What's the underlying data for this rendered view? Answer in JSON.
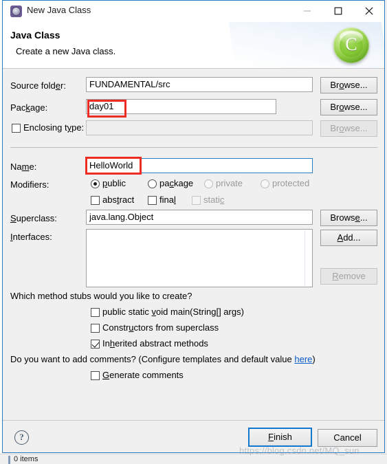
{
  "window": {
    "title": "New Java Class",
    "icon": "eclipse-wizard-icon",
    "controls": {
      "minimize": "—",
      "maximize": "□",
      "close": "✕"
    }
  },
  "banner": {
    "title": "Java Class",
    "subtitle": "Create a new Java class.",
    "logo_letter": "C"
  },
  "form": {
    "source_folder": {
      "label": "Source folder:",
      "value": "FUNDAMENTAL/src",
      "browse_label": "Browse..."
    },
    "package": {
      "label": "Package:",
      "value": "day01",
      "browse_label": "Browse..."
    },
    "enclosing_type": {
      "label": "Enclosing type:",
      "value": "",
      "checked": false,
      "browse_label": "Browse...",
      "disabled": true
    },
    "name": {
      "label": "Name:",
      "value": "HelloWorld"
    },
    "modifiers": {
      "label": "Modifiers:",
      "radios": [
        {
          "label": "public",
          "checked": true,
          "disabled": false
        },
        {
          "label": "package",
          "checked": false,
          "disabled": false
        },
        {
          "label": "private",
          "checked": false,
          "disabled": true
        },
        {
          "label": "protected",
          "checked": false,
          "disabled": true
        }
      ],
      "checkboxes": [
        {
          "label": "abstract",
          "checked": false,
          "disabled": false
        },
        {
          "label": "final",
          "checked": false,
          "disabled": false
        },
        {
          "label": "static",
          "checked": false,
          "disabled": true
        }
      ]
    },
    "superclass": {
      "label": "Superclass:",
      "value": "java.lang.Object",
      "browse_label": "Browse..."
    },
    "interfaces": {
      "label": "Interfaces:",
      "items": [],
      "add_label": "Add...",
      "remove_label": "Remove",
      "remove_disabled": true
    },
    "method_stubs": {
      "question": "Which method stubs would you like to create?",
      "options": [
        {
          "label": "public static void main(String[] args)",
          "checked": false
        },
        {
          "label": "Constructors from superclass",
          "checked": false
        },
        {
          "label": "Inherited abstract methods",
          "checked": true
        }
      ]
    },
    "comments": {
      "question_prefix": "Do you want to add comments? (Configure templates and default value ",
      "link_text": "here",
      "question_suffix": ")",
      "option": {
        "label": "Generate comments",
        "checked": false
      }
    }
  },
  "footer": {
    "help": "?",
    "finish_label": "Finish",
    "cancel_label": "Cancel"
  },
  "overlay": {
    "watermark": "https://blog.csdn.net/MQ_sun",
    "background_status": "0 items",
    "annotation_color": "#ee2b24"
  }
}
